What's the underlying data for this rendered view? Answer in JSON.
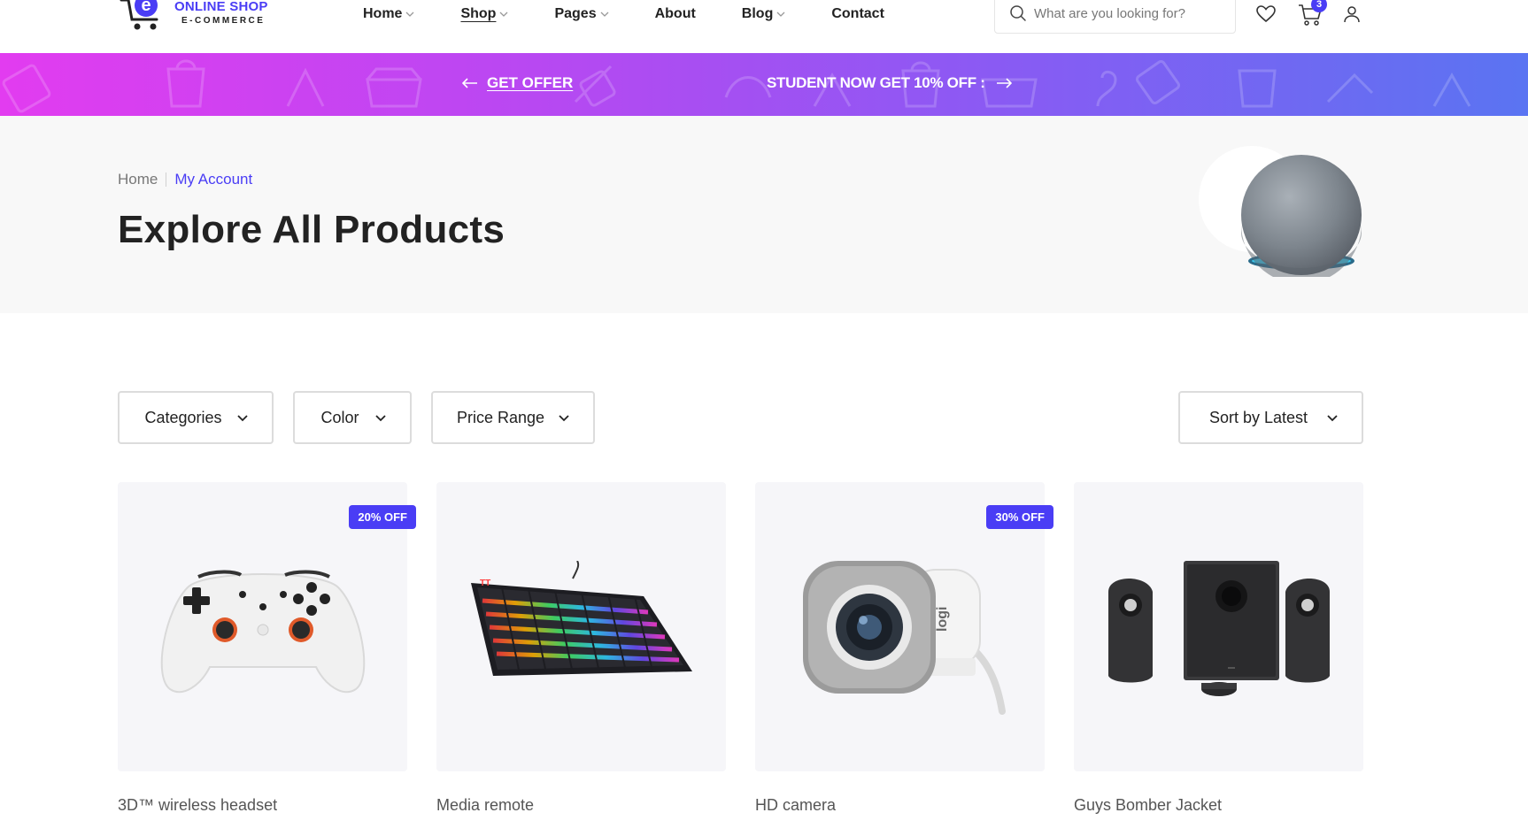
{
  "brand": {
    "title": "ONLINE SHOP",
    "subtitle": "E-COMMERCE",
    "accent": "#4a3df5"
  },
  "nav": {
    "items": [
      {
        "label": "Home",
        "has_dropdown": true,
        "active": false
      },
      {
        "label": "Shop",
        "has_dropdown": true,
        "active": true
      },
      {
        "label": "Pages",
        "has_dropdown": true,
        "active": false
      },
      {
        "label": "About",
        "has_dropdown": false,
        "active": false
      },
      {
        "label": "Blog",
        "has_dropdown": true,
        "active": false
      },
      {
        "label": "Contact",
        "has_dropdown": false,
        "active": false
      }
    ]
  },
  "search": {
    "placeholder": "What are you looking for?"
  },
  "header_icons": {
    "wishlist": "heart-icon",
    "cart": "cart-icon",
    "account": "user-icon",
    "cart_count": "3"
  },
  "promo": {
    "left_label": "GET OFFER",
    "right_text": "STUDENT NOW GET 10% OFF :"
  },
  "page_header": {
    "breadcrumb_home": "Home",
    "breadcrumb_current": "My Account",
    "title": "Explore All Products"
  },
  "filters": {
    "categories": "Categories",
    "color": "Color",
    "price_range": "Price Range",
    "sort": "Sort by Latest"
  },
  "products": [
    {
      "name": "3D™ wireless headset",
      "badge": "20% OFF",
      "image": "game-controller"
    },
    {
      "name": "Media remote",
      "badge": "",
      "image": "rgb-keyboard"
    },
    {
      "name": "HD camera",
      "badge": "30% OFF",
      "image": "webcam"
    },
    {
      "name": "Guys Bomber Jacket",
      "badge": "",
      "image": "speaker-set"
    }
  ]
}
